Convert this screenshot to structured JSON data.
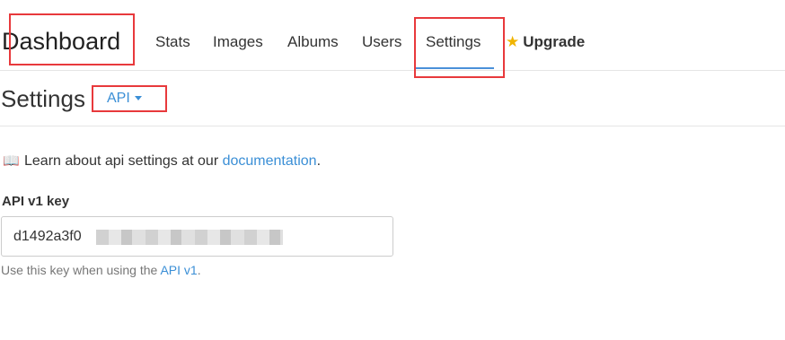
{
  "nav": {
    "brand": "Dashboard",
    "items": [
      {
        "label": "Stats"
      },
      {
        "label": "Images"
      },
      {
        "label": "Albums"
      },
      {
        "label": "Users"
      },
      {
        "label": "Settings",
        "active": true
      }
    ],
    "upgrade": {
      "icon": "star-icon",
      "label": "Upgrade"
    }
  },
  "settings": {
    "title": "Settings",
    "section_dropdown": "API"
  },
  "info": {
    "icon": "book-icon",
    "text_before": "Learn about api settings at our ",
    "link_text": "documentation",
    "text_after": "."
  },
  "api_key": {
    "label": "API v1 key",
    "value": "d1492a3f0",
    "help_before": "Use this key when using the ",
    "help_link": "API v1",
    "help_after": "."
  },
  "colors": {
    "accent": "#3b8fd6",
    "highlight": "#e8393c",
    "star": "#f0b400"
  }
}
